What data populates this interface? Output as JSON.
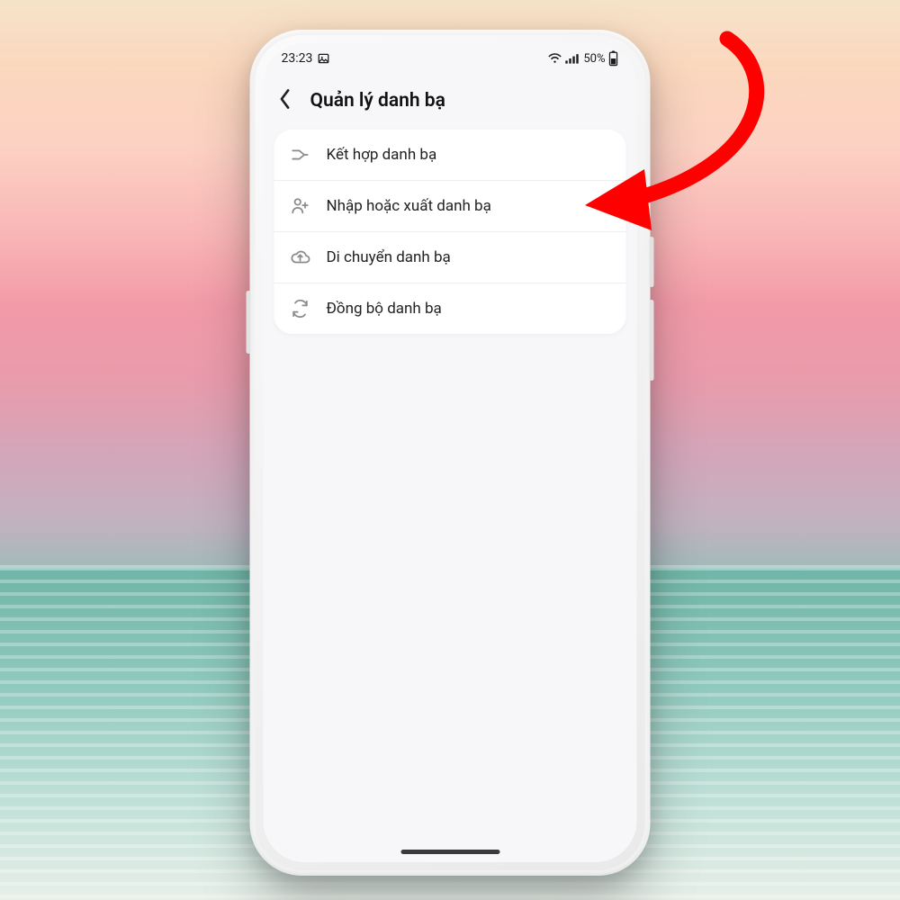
{
  "status": {
    "time": "23:23",
    "left_icons": [
      "picture-icon"
    ],
    "battery_text": "50%",
    "right_icons": [
      "wifi-icon",
      "signal-icon",
      "battery-icon"
    ]
  },
  "header": {
    "title": "Quản lý danh bạ"
  },
  "menu": {
    "items": [
      {
        "icon": "merge-icon",
        "label": "Kết hợp danh bạ"
      },
      {
        "icon": "person-plus-icon",
        "label": "Nhập hoặc xuất danh bạ"
      },
      {
        "icon": "cloud-upload-icon",
        "label": "Di chuyển danh bạ"
      },
      {
        "icon": "sync-icon",
        "label": "Đồng bộ danh bạ"
      }
    ]
  },
  "annotation": {
    "type": "arrow",
    "color": "#ff0000",
    "points_to_item_index": 1
  }
}
